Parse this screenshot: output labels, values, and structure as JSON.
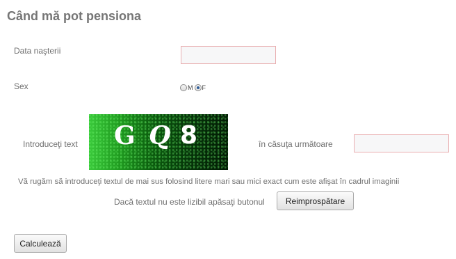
{
  "form": {
    "title": "Când mă pot pensiona",
    "birth_date_label": "Data naşterii",
    "birth_date_value": "",
    "sex_label": "Sex",
    "sex_options": [
      {
        "label": "M",
        "checked": false
      },
      {
        "label": "F",
        "checked": true
      }
    ],
    "captcha_intro_label": "Introduceţi text",
    "captcha_text": [
      "G",
      "Q",
      "8"
    ],
    "captcha_box_label": "în căsuţa următoare",
    "captcha_value": "",
    "instruction_text": "Vă rugăm să introduceţi textul de mai sus folosind litere mari sau mici exact cum este afişat în cadrul imaginii",
    "refresh_hint": "Dacă textul nu este lizibil apăsaţi butonul",
    "refresh_button_label": "Reimprospătare",
    "submit_button_label": "Calculează"
  },
  "colors": {
    "input_border": "#e9aeb0",
    "captcha_dark": "#021a04",
    "captcha_light": "#39c83a"
  }
}
